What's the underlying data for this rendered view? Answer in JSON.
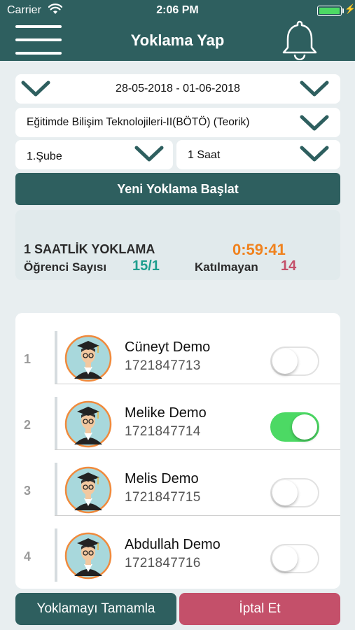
{
  "status_bar": {
    "carrier": "Carrier",
    "time": "2:06 PM",
    "wifi_icon": "wifi-icon",
    "battery_icon": "battery-icon"
  },
  "nav": {
    "title": "Yoklama Yap",
    "menu_icon": "hamburger-icon",
    "bell_icon": "bell-icon"
  },
  "filters": {
    "date_range": "28-05-2018 - 01-06-2018",
    "course": "Eğitimde Bilişim Teknolojileri-II(BÖTÖ) (Teorik)",
    "section": "1.Şube",
    "hours": "1 Saat"
  },
  "start_button": "Yeni Yoklama Başlat",
  "summary": {
    "title": "1 SAATLİK YOKLAMA",
    "timer": "0:59:41",
    "student_count_label": "Öğrenci Sayısı",
    "student_count_value": "15/1",
    "absent_label": "Katılmayan",
    "absent_value": "14"
  },
  "students": [
    {
      "index": "1",
      "name": "Cüneyt Demo",
      "number": "1721847713",
      "present": false
    },
    {
      "index": "2",
      "name": "Melike Demo",
      "number": "1721847714",
      "present": true
    },
    {
      "index": "3",
      "name": "Melis Demo",
      "number": "1721847715",
      "present": false
    },
    {
      "index": "4",
      "name": "Abdullah Demo",
      "number": "1721847716",
      "present": false
    }
  ],
  "footer": {
    "complete_label": "Yoklamayı Tamamla",
    "cancel_label": "İptal Et"
  },
  "colors": {
    "primary": "#2e5f5f",
    "timer": "#f0821e",
    "count": "#1e9e8e",
    "absent": "#c4506a",
    "cancel": "#c4506a",
    "toggle_on": "#4cd964"
  }
}
